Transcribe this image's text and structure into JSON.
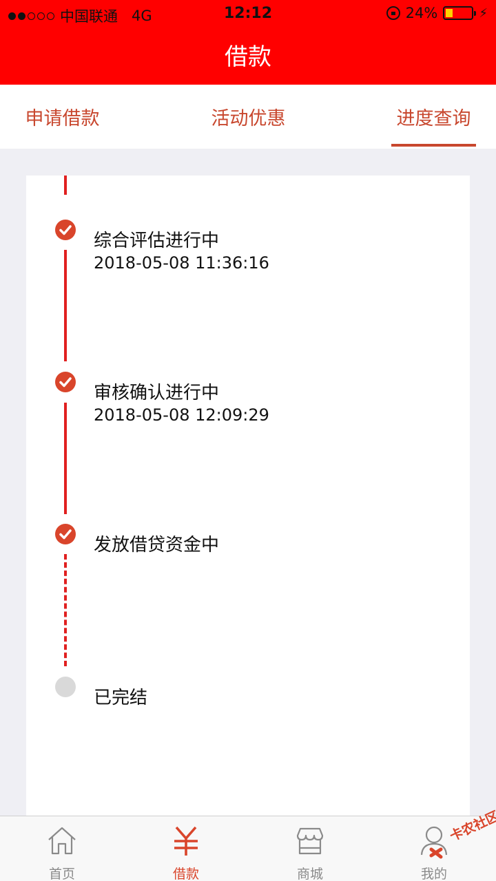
{
  "status_bar": {
    "carrier": "中国联通",
    "network": "4G",
    "time": "12:12",
    "battery": "24%"
  },
  "header": {
    "title": "借款"
  },
  "tabs": [
    {
      "label": "申请借款",
      "active": false
    },
    {
      "label": "活动优惠",
      "active": false
    },
    {
      "label": "进度查询",
      "active": true
    }
  ],
  "progress": {
    "steps": [
      {
        "title": "综合评估进行中",
        "time": "2018-05-08 11:36:16",
        "status": "done"
      },
      {
        "title": "审核确认进行中",
        "time": "2018-05-08 12:09:29",
        "status": "done"
      },
      {
        "title": "发放借贷资金中",
        "time": "",
        "status": "done"
      },
      {
        "title": "已完结",
        "time": "",
        "status": "pending"
      }
    ]
  },
  "tabbar": {
    "items": [
      {
        "label": "首页",
        "icon": "home-icon"
      },
      {
        "label": "借款",
        "icon": "yen-icon",
        "active": true
      },
      {
        "label": "商城",
        "icon": "shop-icon"
      },
      {
        "label": "我的",
        "icon": "user-icon"
      }
    ]
  },
  "watermark": {
    "text": "卡农社区"
  },
  "colors": {
    "header": "#ff0000",
    "accent": "#c8472e",
    "check": "#d9452b",
    "line": "#e02020",
    "background": "#efeff4"
  }
}
